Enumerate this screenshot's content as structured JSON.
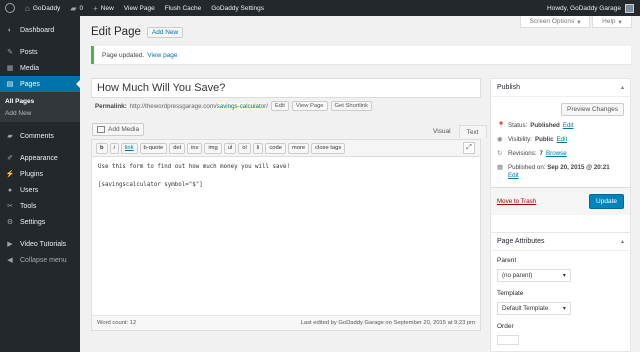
{
  "adminbar": {
    "site_name": "GoDaddy",
    "comments_count": "0",
    "new_label": "New",
    "view_page": "View Page",
    "flush_cache": "Flush Cache",
    "godaddy_settings": "GoDaddy Settings",
    "howdy": "Howdy, GoDaddy Garage"
  },
  "sidebar": {
    "items": [
      {
        "label": "Dashboard",
        "icon": "dashboard-icon"
      },
      {
        "label": "Posts",
        "icon": "pin-icon"
      },
      {
        "label": "Media",
        "icon": "media-icon"
      },
      {
        "label": "Pages",
        "icon": "page-icon"
      },
      {
        "label": "Comments",
        "icon": "comment-icon"
      },
      {
        "label": "Appearance",
        "icon": "brush-icon"
      },
      {
        "label": "Plugins",
        "icon": "plugin-icon"
      },
      {
        "label": "Users",
        "icon": "user-icon"
      },
      {
        "label": "Tools",
        "icon": "wrench-icon"
      },
      {
        "label": "Settings",
        "icon": "settings-icon"
      },
      {
        "label": "Video Tutorials",
        "icon": "video-icon"
      },
      {
        "label": "Collapse menu",
        "icon": "collapse-icon"
      }
    ],
    "submenu": [
      "All Pages",
      "Add New"
    ]
  },
  "screen_meta": {
    "screen_options": "Screen Options",
    "help": "Help"
  },
  "header": {
    "title": "Edit Page",
    "add_new": "Add New"
  },
  "notice": {
    "text": "Page updated.",
    "link": "View page"
  },
  "post": {
    "title": "How Much Will You Save?",
    "permalink_label": "Permalink:",
    "permalink_base": "http://thewordpressgarage.com/",
    "permalink_slug": "savings-calculator",
    "permalink_end": "/",
    "edit_btn": "Edit",
    "view_page_btn": "View Page",
    "shortlink_btn": "Get Shortlink"
  },
  "editor": {
    "add_media": "Add Media",
    "tab_visual": "Visual",
    "tab_text": "Text",
    "qt_buttons": [
      "b",
      "i",
      "link",
      "b-quote",
      "del",
      "ins",
      "img",
      "ul",
      "ol",
      "li",
      "code",
      "more",
      "close tags"
    ],
    "content_line1": "Use this form to find out how much money you will save!",
    "content_line2": "[savingscalculator symbol=\"$\"]",
    "word_count": "Word count: 12",
    "last_edited": "Last edited by GoDaddy Garage on September 20, 2015 at 9:23 pm"
  },
  "publish": {
    "title": "Publish",
    "preview": "Preview Changes",
    "status_label": "Status:",
    "status_value": "Published",
    "visibility_label": "Visibility:",
    "visibility_value": "Public",
    "revisions_label": "Revisions:",
    "revisions_value": "7",
    "browse": "Browse",
    "published_on_label": "Published on:",
    "published_on_value": "Sep 20, 2015 @ 20:21",
    "edit": "Edit",
    "trash": "Move to Trash",
    "update": "Update"
  },
  "attributes": {
    "title": "Page Attributes",
    "parent_label": "Parent",
    "parent_value": "(no parent)",
    "template_label": "Template",
    "template_value": "Default Template",
    "order_label": "Order"
  },
  "colors": {
    "admin_dark": "#23282d",
    "accent": "#0073aa",
    "primary_button": "#0085ba",
    "notice_green": "#46b450"
  }
}
